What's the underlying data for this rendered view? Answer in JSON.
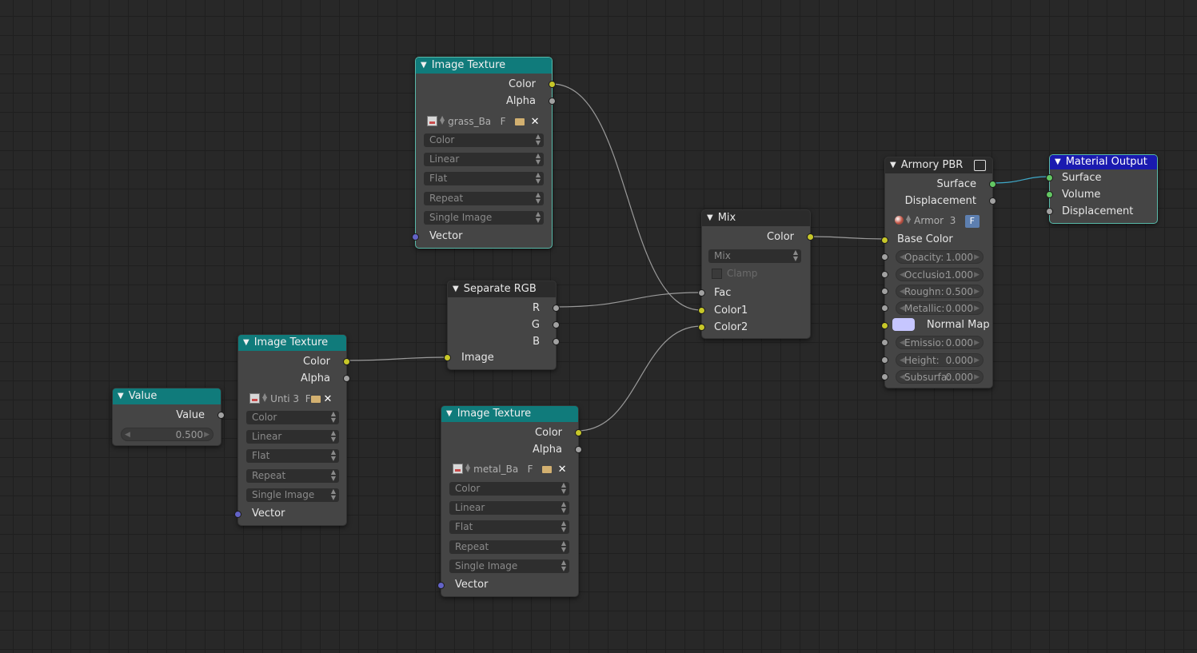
{
  "editor": "Node Editor",
  "colors": {
    "background": "#282828",
    "node_body": "#454545",
    "texture_header": "#107b7b",
    "converter_header": "#2b2b2b",
    "output_header": "#1a1ab0",
    "socket_color": "#c7c729",
    "socket_float": "#a1a1a1",
    "socket_vector": "#6363c7",
    "socket_shader": "#63c763"
  },
  "nodes": {
    "image_texture_grass": {
      "title": "Image Texture",
      "out_color": "Color",
      "out_alpha": "Alpha",
      "image_name": "grass_Ba",
      "fake_user": "F",
      "color_space": "Color",
      "interpolation": "Linear",
      "projection": "Flat",
      "extension": "Repeat",
      "source": "Single Image",
      "in_vector": "Vector"
    },
    "image_texture_unti": {
      "title": "Image Texture",
      "out_color": "Color",
      "out_alpha": "Alpha",
      "image_name": "Unti",
      "users": "3",
      "fake_user": "F",
      "color_space": "Color",
      "interpolation": "Linear",
      "projection": "Flat",
      "extension": "Repeat",
      "source": "Single Image",
      "in_vector": "Vector"
    },
    "image_texture_metal": {
      "title": "Image Texture",
      "out_color": "Color",
      "out_alpha": "Alpha",
      "image_name": "metal_Ba",
      "fake_user": "F",
      "color_space": "Color",
      "interpolation": "Linear",
      "projection": "Flat",
      "extension": "Repeat",
      "source": "Single Image",
      "in_vector": "Vector"
    },
    "value": {
      "title": "Value",
      "out_value": "Value",
      "field_value": "0.500"
    },
    "separate_rgb": {
      "title": "Separate RGB",
      "out_r": "R",
      "out_g": "G",
      "out_b": "B",
      "in_image": "Image"
    },
    "mix": {
      "title": "Mix",
      "out_color": "Color",
      "blend_type": "Mix",
      "clamp_label": "Clamp",
      "in_fac": "Fac",
      "in_color1": "Color1",
      "in_color2": "Color2"
    },
    "armory_pbr": {
      "title": "Armory PBR",
      "out_surface": "Surface",
      "out_displacement": "Displacement",
      "material_name": "Armor",
      "material_users": "3",
      "fake_user": "F",
      "in_base_color": "Base Color",
      "opacity_label": "Opacity:",
      "opacity_value": "1.000",
      "occlusion_label": "Occlusio:",
      "occlusion_value": "1.000",
      "roughness_label": "Roughn:",
      "roughness_value": "0.500",
      "metallic_label": "Metallic:",
      "metallic_value": "0.000",
      "normal_map_label": "Normal Map",
      "normal_map_color": "#c6c6ff",
      "emission_label": "Emissio:",
      "emission_value": "0.000",
      "height_label": "Height:",
      "height_value": "0.000",
      "subsurface_label": "Subsurfa:",
      "subsurface_value": "0.000"
    },
    "material_output": {
      "title": "Material Output",
      "in_surface": "Surface",
      "in_volume": "Volume",
      "in_displacement": "Displacement"
    }
  }
}
